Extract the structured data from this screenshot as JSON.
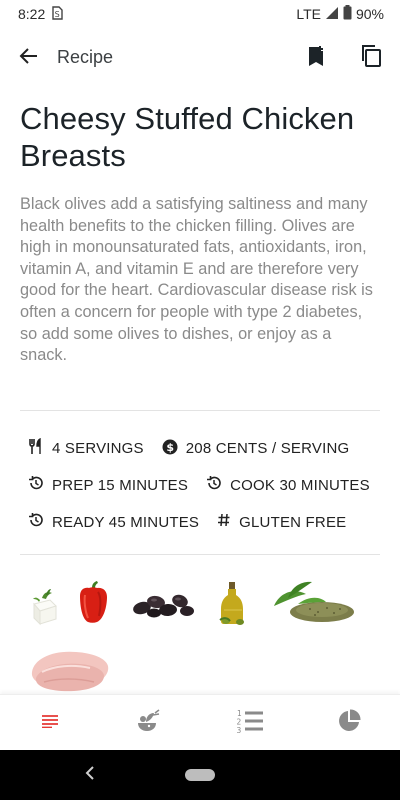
{
  "status_bar": {
    "time": "8:22",
    "network": "LTE",
    "battery": "90%"
  },
  "app_bar": {
    "title": "Recipe",
    "back_icon": "arrow-left-icon",
    "bookmark_icon": "bookmark-add-icon",
    "copy_icon": "copy-icon"
  },
  "recipe": {
    "title": "Cheesy Stuffed Chicken Breasts",
    "description": "Black olives add a satisfying saltiness and many health benefits to the chicken filling. Olives are high in monounsaturated fats, antioxidants, iron, vitamin A, and vitamin E and are therefore very good for the heart. Cardiovascular disease risk is often a concern for people with type 2 diabetes, so add some olives to dishes, or enjoy as a snack."
  },
  "meta": {
    "servings": "4 SERVINGS",
    "cost": "208 CENTS / SERVING",
    "prep": "PREP 15 MINUTES",
    "cook": "COOK 30 MINUTES",
    "ready": "READY 45 MINUTES",
    "diet": "GLUTEN FREE"
  },
  "ingredients": [
    "feta-cheese",
    "red-bell-pepper",
    "black-olives",
    "olive-oil",
    "basil-oregano",
    "chicken-breast"
  ],
  "bottom_nav": [
    {
      "name": "summary",
      "icon": "summary-lines-icon",
      "active": true
    },
    {
      "name": "ingredients",
      "icon": "ingredients-icon",
      "active": false
    },
    {
      "name": "steps",
      "icon": "numbered-list-icon",
      "active": false
    },
    {
      "name": "nutrition",
      "icon": "pie-chart-icon",
      "active": false
    }
  ],
  "colors": {
    "accent": "#e53935",
    "icon_gray": "#757575",
    "text_dark": "#1c2328",
    "text_muted": "#8a8a8a"
  }
}
